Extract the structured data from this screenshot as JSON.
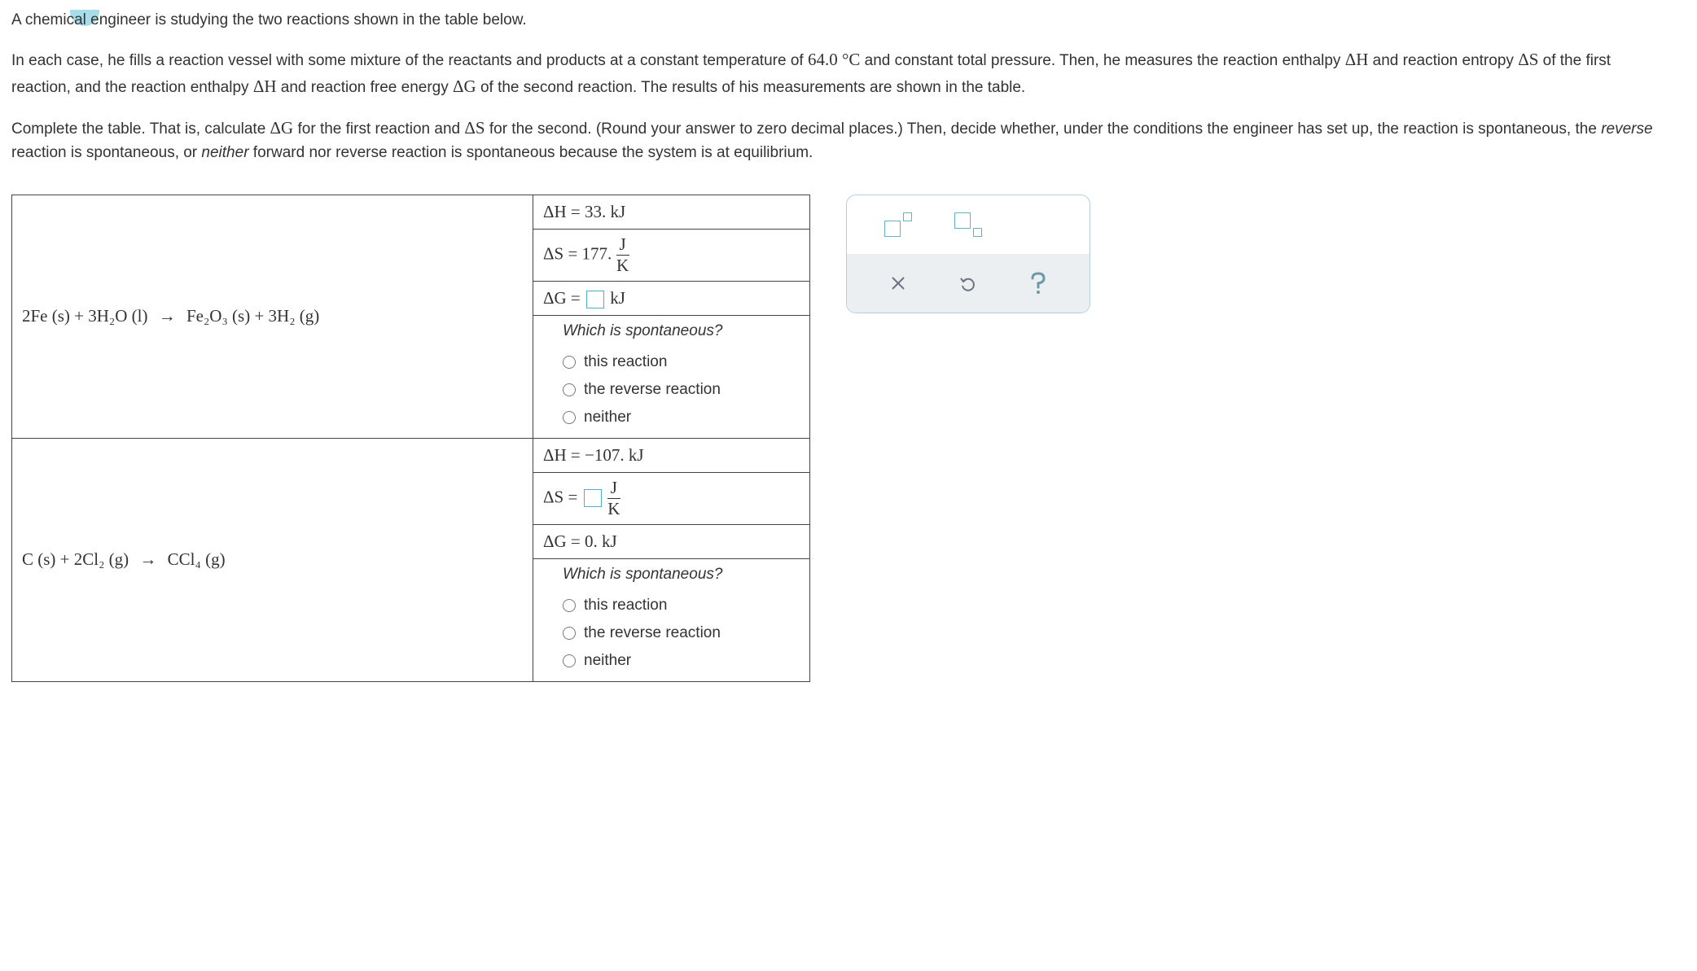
{
  "intro": {
    "p1_pre": "A chemica",
    "p1_mid": "l e",
    "p1_post": "ngineer is studying the two reactions shown in the table below.",
    "p2a": "In each case, he fills a reaction vessel with some mixture of the reactants and products at a constant temperature of ",
    "p2temp": "64.0 °C",
    "p2b": " and constant total pressure. Then, he measures the reaction enthalpy ",
    "deltaH": "ΔH",
    "p2c": " and reaction entropy ",
    "deltaS": "ΔS",
    "p2d": " of the first reaction, and the reaction enthalpy ",
    "p2e": " and reaction free energy ",
    "deltaG": "ΔG",
    "p2f": " of the second reaction. The results of his measurements are shown in the table.",
    "p3a": "Complete the table. That is, calculate ",
    "p3b": " for the first reaction and ",
    "p3c": " for the second. (Round your answer to zero decimal places.) Then, decide whether, under the conditions the engineer has set up, the reaction is spontaneous, the ",
    "reverse": "reverse",
    "p3d": " reaction is spontaneous, or ",
    "neither": "neither",
    "p3e": " forward nor reverse reaction is spontaneous because the system is at equilibrium."
  },
  "rxn1": {
    "eq_lhs": "2Fe (s) + 3H₂O (l)",
    "eq_arrow": "→",
    "eq_rhs": "Fe₂O₃ (s) + 3H₂ (g)",
    "dH_label": "ΔH",
    "dH_val": "= 33. kJ",
    "dS_label": "ΔS",
    "dS_val": "= 177.",
    "frac_J": "J",
    "frac_K": "K",
    "dG_label": "ΔG",
    "dG_eq": "=",
    "dG_unit": "kJ",
    "spon_head": "Which is spontaneous?",
    "opt1": "this reaction",
    "opt2": "the reverse reaction",
    "opt3": "neither"
  },
  "rxn2": {
    "eq_lhs": "C (s) + 2Cl₂ (g)",
    "eq_arrow": "→",
    "eq_rhs": "CCl₄ (g)",
    "dH_label": "ΔH",
    "dH_val": "= −107. kJ",
    "dS_label": "ΔS",
    "dS_eq": "=",
    "frac_J": "J",
    "frac_K": "K",
    "dG_label": "ΔG",
    "dG_val": "= 0. kJ",
    "spon_head": "Which is spontaneous?",
    "opt1": "this reaction",
    "opt2": "the reverse reaction",
    "opt3": "neither"
  }
}
